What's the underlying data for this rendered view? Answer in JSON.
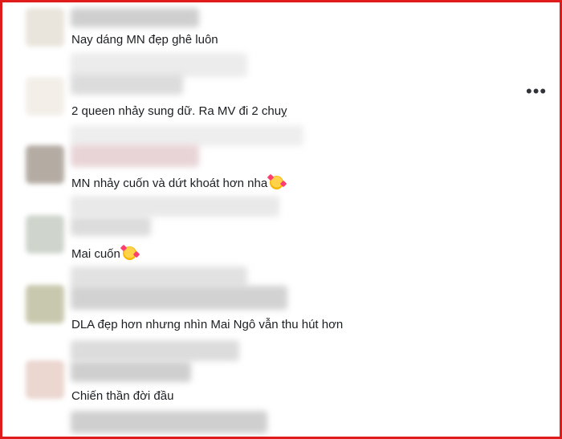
{
  "comments": [
    {
      "text": "Nay dáng MN đẹp ghê luôn",
      "emoji": false
    },
    {
      "text": "2 queen nhảy sung dữ. Ra MV đi 2 chuỵ",
      "emoji": false
    },
    {
      "text": "MN nhảy cuốn và dứt khoát hơn nha",
      "emoji": true
    },
    {
      "text": "Mai cuốn",
      "emoji": true
    },
    {
      "text": "DLA đẹp hơn nhưng nhìn Mai Ngô vẫn thu hút hơn",
      "emoji": false
    },
    {
      "text": "Chiến thần đời đầu",
      "emoji": false
    }
  ],
  "more_options": "•••",
  "colors": {
    "frame": "#e01b1b",
    "text": "#1c1e21"
  },
  "emoji_icon": "smiling-face-with-hearts-icon"
}
